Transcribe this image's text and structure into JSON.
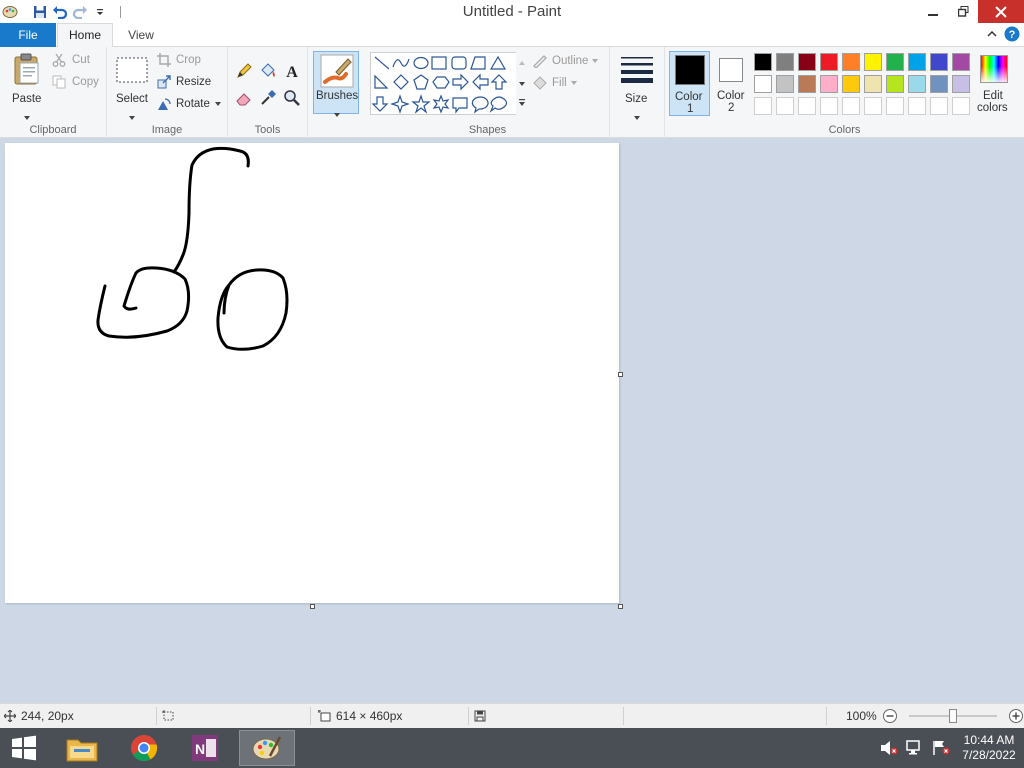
{
  "window": {
    "title": "Untitled - Paint"
  },
  "tabs": {
    "file": "File",
    "home": "Home",
    "view": "View"
  },
  "ribbon": {
    "clipboard": {
      "label": "Clipboard",
      "paste": "Paste",
      "cut": "Cut",
      "copy": "Copy"
    },
    "image": {
      "label": "Image",
      "select": "Select",
      "crop": "Crop",
      "resize": "Resize",
      "rotate": "Rotate"
    },
    "tools": {
      "label": "Tools"
    },
    "brushes": {
      "label": "Brushes"
    },
    "shapes": {
      "label": "Shapes",
      "outline": "Outline",
      "fill": "Fill"
    },
    "size": {
      "label": "Size"
    },
    "colors": {
      "label": "Colors",
      "color1_line1": "Color",
      "color1_line2": "1",
      "color2_line1": "Color",
      "color2_line2": "2",
      "edit_line1": "Edit",
      "edit_line2": "colors",
      "color1": "#000000",
      "color2": "#ffffff",
      "palette_row1": [
        "#000000",
        "#7f7f7f",
        "#880015",
        "#ed1c24",
        "#ff7f27",
        "#fff200",
        "#22b14c",
        "#00a2e8",
        "#3f48cc",
        "#a349a4"
      ],
      "palette_row2": [
        "#ffffff",
        "#c3c3c3",
        "#b97a57",
        "#ffaec9",
        "#ffc90e",
        "#efe4b0",
        "#b5e61d",
        "#99d9ea",
        "#7092be",
        "#c8bfe7"
      ]
    }
  },
  "status": {
    "cursor_pos": "244, 20px",
    "canvas_size": "614 × 460px",
    "zoom": "100%"
  },
  "taskbar": {
    "time": "10:44 AM",
    "date": "7/28/2022"
  },
  "accent": "#1979ca"
}
